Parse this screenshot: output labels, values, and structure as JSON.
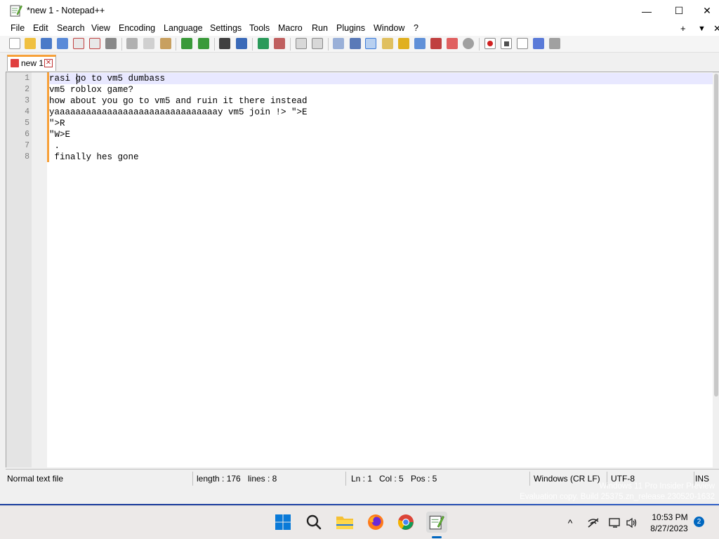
{
  "window": {
    "title": "*new 1 - Notepad++",
    "controls": {
      "minimize": "—",
      "maximize": "☐",
      "close": "✕"
    }
  },
  "menu": {
    "items": [
      "File",
      "Edit",
      "Search",
      "View",
      "Encoding",
      "Language",
      "Settings",
      "Tools",
      "Macro",
      "Run",
      "Plugins",
      "Window",
      "?"
    ],
    "right": [
      "+",
      "▼",
      "✕"
    ]
  },
  "toolbar": {
    "icons": [
      "new-file-icon",
      "open-file-icon",
      "save-icon",
      "save-all-icon",
      "close-icon",
      "close-all-icon",
      "print-icon",
      "cut-icon",
      "copy-icon",
      "paste-icon",
      "undo-icon",
      "redo-icon",
      "find-icon",
      "replace-icon",
      "zoom-in-icon",
      "zoom-out-icon",
      "sync-vertical-icon",
      "sync-horizontal-icon",
      "word-wrap-icon",
      "show-all-chars-icon",
      "indent-guide-icon",
      "language-icon",
      "doc-map-icon",
      "function-list-icon",
      "folder-workspace-icon",
      "monitoring-icon",
      "record-macro-icon",
      "stop-macro-icon",
      "play-macro-icon",
      "run-macro-multiple-icon",
      "save-macro-icon"
    ]
  },
  "tabs": [
    {
      "label": "new 1",
      "close": "✕"
    }
  ],
  "editor": {
    "lines": [
      {
        "number": "1",
        "text": "rasi go to vm5 dumbass"
      },
      {
        "number": "2",
        "text": "vm5 roblox game?"
      },
      {
        "number": "3",
        "text": "how about you go to vm5 and ruin it there instead"
      },
      {
        "number": "4",
        "text": "yaaaaaaaaaaaaaaaaaaaaaaaaaaaaaaay vm5 join !> \">E"
      },
      {
        "number": "5",
        "text": "\">R"
      },
      {
        "number": "6",
        "text": "\"W>E"
      },
      {
        "number": "7",
        "text": " ."
      },
      {
        "number": "8",
        "text": " finally hes gone"
      }
    ]
  },
  "status": {
    "file_type": "Normal text file",
    "length": "length : 176",
    "lines": "lines : 8",
    "ln": "Ln : 1",
    "col": "Col : 5",
    "pos": "Pos : 5",
    "eol": "Windows (CR LF)",
    "encoding": "UTF-8",
    "mode": "INS"
  },
  "watermark": {
    "line1": "Windows 11 Pro Insider Preview",
    "line2": "Evaluation copy. Build 25375.zn_release.230520-1632"
  },
  "taskbar": {
    "apps": [
      "start-icon",
      "search-icon",
      "file-explorer-icon",
      "firefox-icon",
      "chrome-icon",
      "notepadpp-icon"
    ],
    "tray": {
      "chevron": "^",
      "time": "10:53 PM",
      "date": "8/27/2023",
      "notifications": "2"
    }
  },
  "colors": {
    "tab_accent": "#f7a13a",
    "current_line": "#e8e8ff",
    "taskbar_accent": "#0067c0"
  }
}
